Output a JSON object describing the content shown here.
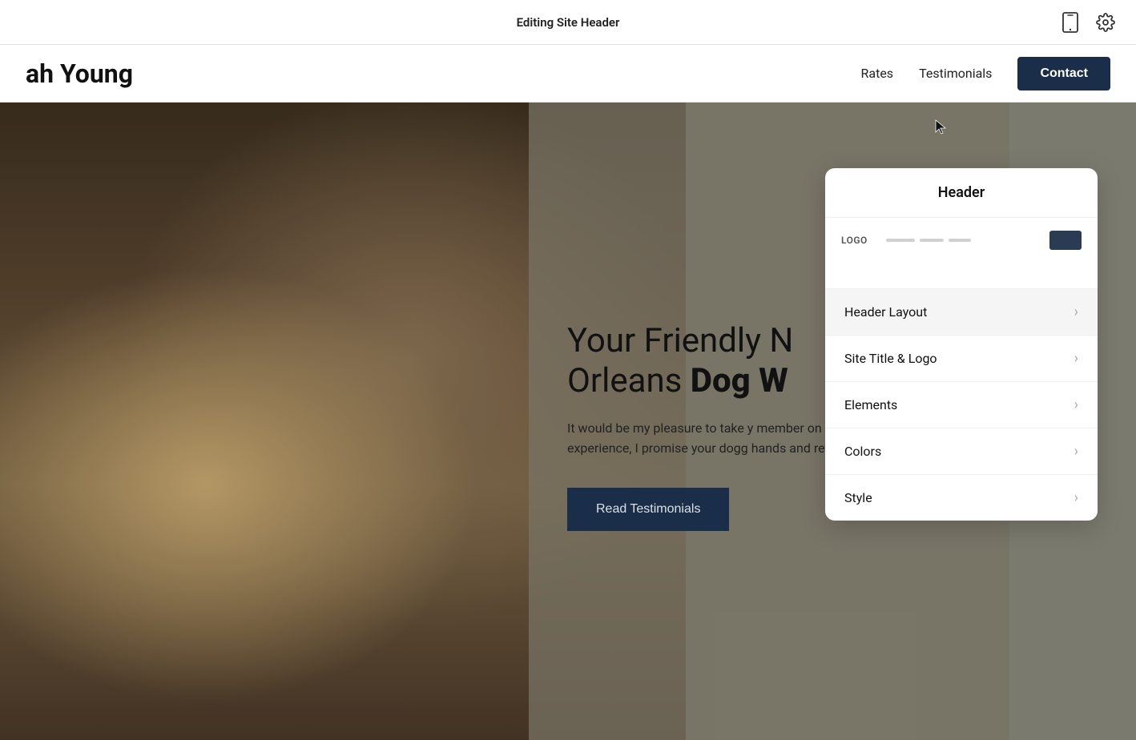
{
  "topbar": {
    "title": "Editing Site Header",
    "mobile_icon": "📱",
    "settings_icon": "⚙"
  },
  "siteHeader": {
    "title": "ah Young",
    "nav": {
      "rates": "Rates",
      "testimonials": "Testimonials",
      "contact": "Contact"
    }
  },
  "hero": {
    "heading_part1": "Your Friendly N",
    "heading_part2": "Orleans ",
    "heading_bold": "Dog W",
    "body": "It would be my pleasure to take y member on an energetic walk. W experience, I promise your dogg hands and return energized with",
    "cta": "Read Testimonials"
  },
  "panel": {
    "title": "Header",
    "logo_label": "LOGO",
    "items": [
      {
        "label": "Header Layout",
        "active": true
      },
      {
        "label": "Site Title & Logo",
        "active": false
      },
      {
        "label": "Elements",
        "active": false
      },
      {
        "label": "Colors",
        "active": false
      },
      {
        "label": "Style",
        "active": false
      }
    ]
  }
}
